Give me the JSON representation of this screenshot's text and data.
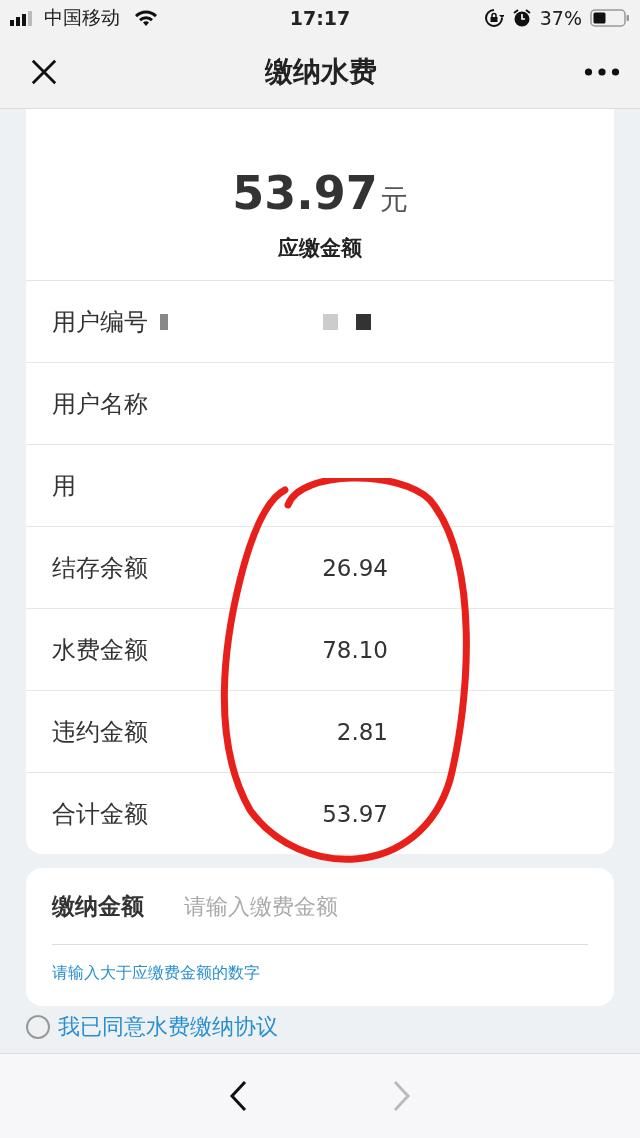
{
  "status_bar": {
    "carrier": "中国移动",
    "time": "17:17",
    "battery": "37%"
  },
  "nav": {
    "title": "缴纳水费"
  },
  "summary": {
    "amount": "53.97",
    "unit": "元",
    "label": "应缴金额"
  },
  "rows": [
    {
      "label": "用户编号",
      "value": "",
      "redacted": true
    },
    {
      "label": "用户名称",
      "value": "",
      "redacted": false
    },
    {
      "label": "用",
      "value": "",
      "redacted": false
    },
    {
      "label": "结存余额",
      "value": "26.94",
      "redacted": false
    },
    {
      "label": "水费金额",
      "value": "78.10",
      "redacted": false
    },
    {
      "label": "违约金额",
      "value": "2.81",
      "redacted": false
    },
    {
      "label": "合计金额",
      "value": "53.97",
      "redacted": false
    }
  ],
  "payment": {
    "label": "缴纳金额",
    "placeholder": "请输入缴费金额",
    "hint": "请输入大于应缴费金额的数字"
  },
  "agreement": {
    "text": "我已同意水费缴纳协议",
    "checked": false
  },
  "toolbar": {
    "back_disabled": false,
    "forward_disabled": true
  }
}
